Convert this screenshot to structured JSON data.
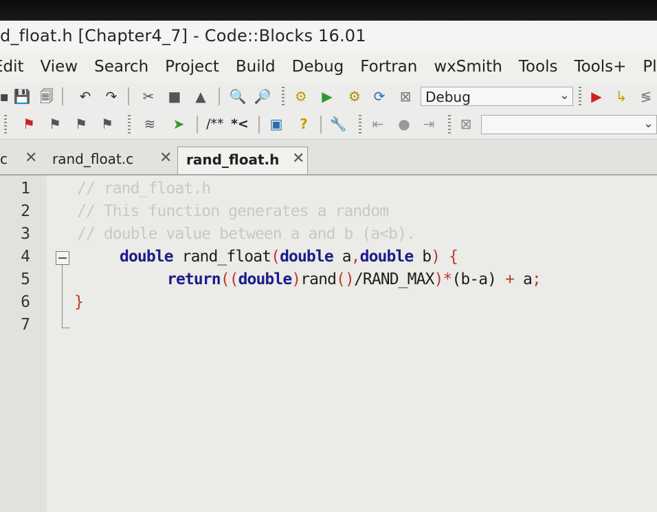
{
  "window": {
    "title": "d_float.h [Chapter4_7] - Code::Blocks 16.01"
  },
  "menu": [
    "Edit",
    "View",
    "Search",
    "Project",
    "Build",
    "Debug",
    "Fortran",
    "wxSmith",
    "Tools",
    "Tools+",
    "Plug"
  ],
  "toolbar": {
    "build_target": "Debug",
    "comment_block_label": "/**",
    "comment_line_label": "*<",
    "search_box_value": ""
  },
  "tabs": [
    {
      "label": "c",
      "active": false
    },
    {
      "label": "rand_float.c",
      "active": false
    },
    {
      "label": "rand_float.h",
      "active": true
    }
  ],
  "editor": {
    "line_numbers": [
      "1",
      "2",
      "3",
      "4",
      "5",
      "6",
      "7"
    ],
    "lines": [
      "// rand_float.h",
      "// This function generates a random",
      "// double value between a and b (a<b).",
      "double rand_float(double a,double b) {",
      "    return((double)rand()/RAND_MAX)*(b-a) + a;",
      "}",
      ""
    ],
    "tokens": {
      "kw_double": "double",
      "fn_name": "rand_float",
      "paren_open": "(",
      "comma": ",",
      "param_a": "a",
      "param_b": "b",
      "paren_close": ")",
      "brace_open": "{",
      "kw_return": "return",
      "double_paren_open": "((",
      "cast_close": ")",
      "rand_call": "rand",
      "rand_parens": "()",
      "div_randmax": "/RAND_MAX",
      "close_paren": ")",
      "mult": "*",
      "diff": "(b-a)",
      "plus": "+",
      "semicolon": ";",
      "brace_close": "}"
    }
  },
  "colors": {
    "keyword": "#1c1c8c",
    "comment": "#c8c8c5",
    "operator": "#c0392b",
    "run_green": "#2e9a2e",
    "stop_red": "#cc2222"
  }
}
